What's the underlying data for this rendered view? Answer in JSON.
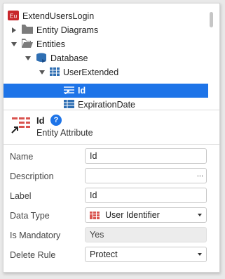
{
  "tree": {
    "root": {
      "badge": "Eu",
      "label": "ExtendUsersLogin"
    },
    "items": [
      {
        "label": "Entity Diagrams"
      },
      {
        "label": "Entities"
      },
      {
        "label": "Database"
      },
      {
        "label": "UserExtended"
      },
      {
        "label": "Id",
        "selected": true
      },
      {
        "label": "ExpirationDate"
      }
    ]
  },
  "header": {
    "title": "Id",
    "help": "?",
    "subtitle": "Entity Attribute"
  },
  "properties": {
    "name": {
      "label": "Name",
      "value": "Id"
    },
    "description": {
      "label": "Description",
      "value": "",
      "button": "..."
    },
    "label": {
      "label": "Label",
      "value": "Id"
    },
    "data_type": {
      "label": "Data Type",
      "value": "User Identifier"
    },
    "is_mandatory": {
      "label": "Is Mandatory",
      "value": "Yes"
    },
    "delete_rule": {
      "label": "Delete Rule",
      "value": "Protect"
    }
  },
  "colors": {
    "selection": "#1e74e8",
    "badge": "#c8262b",
    "grid_icon": "#2f6fb3"
  }
}
